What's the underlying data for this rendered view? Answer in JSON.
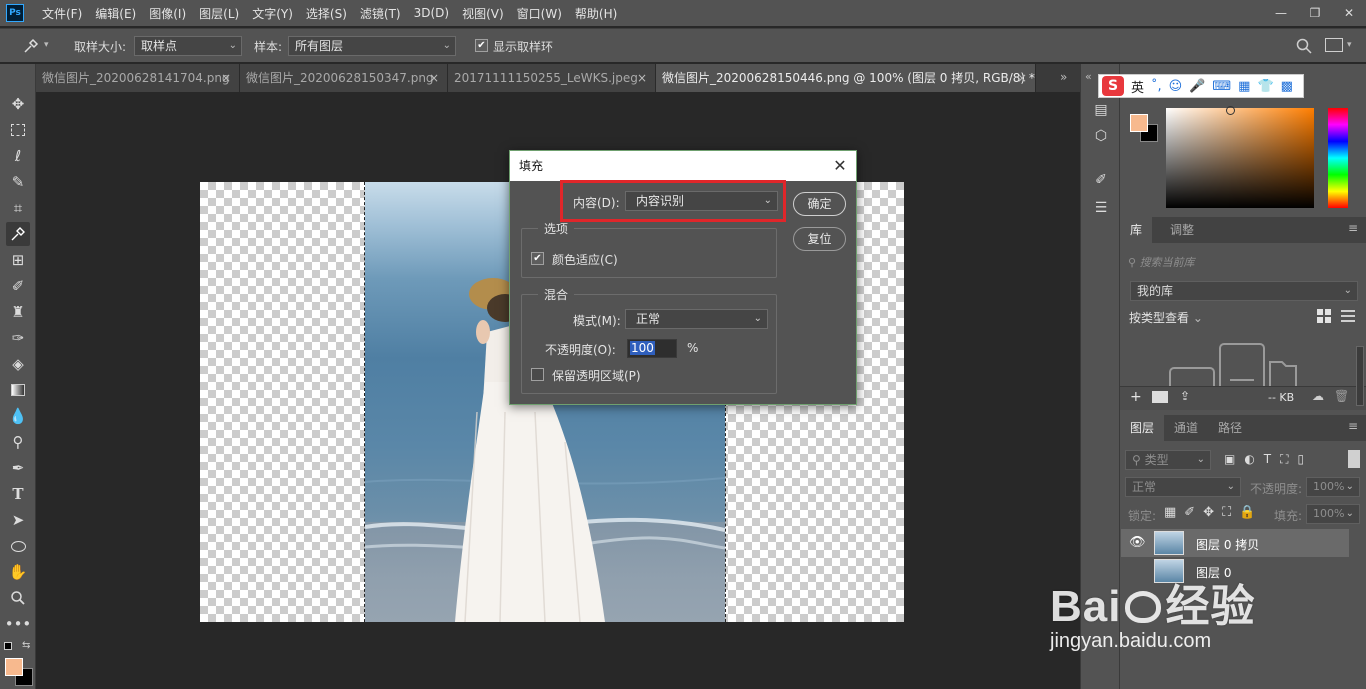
{
  "app": {
    "logo": "Ps"
  },
  "menu": [
    "文件(F)",
    "编辑(E)",
    "图像(I)",
    "图层(L)",
    "文字(Y)",
    "选择(S)",
    "滤镜(T)",
    "3D(D)",
    "视图(V)",
    "窗口(W)",
    "帮助(H)"
  ],
  "window_controls": [
    "—",
    "❐",
    "✕"
  ],
  "options": {
    "sample_size_label": "取样大小:",
    "sample_size_value": "取样点",
    "sample_label": "样本:",
    "sample_value": "所有图层",
    "show_ring_label": "显示取样环",
    "show_ring_checked": true
  },
  "tabs": [
    {
      "label": "微信图片_20200628141704.png",
      "close": "×"
    },
    {
      "label": "微信图片_20200628150347.png",
      "close": "×"
    },
    {
      "label": "20171111150255_LeWKS.jpeg",
      "close": "×"
    },
    {
      "label": "微信图片_20200628150446.png @ 100% (图层 0 拷贝, RGB/8) *",
      "close": "×"
    }
  ],
  "dialog": {
    "title": "填充",
    "close": "✕",
    "content_label": "内容(D):",
    "content_value": "内容识别",
    "ok": "确定",
    "reset": "复位",
    "options_legend": "选项",
    "color_adapt_label": "颜色适应(C)",
    "color_adapt_checked": true,
    "blend_legend": "混合",
    "mode_label": "模式(M):",
    "mode_value": "正常",
    "opacity_label": "不透明度(O):",
    "opacity_value": "100",
    "opacity_unit": "%",
    "preserve_label": "保留透明区域(P)",
    "preserve_checked": false
  },
  "ime": {
    "logo": "S",
    "lang": "英"
  },
  "library": {
    "tabs": [
      "库",
      "调整"
    ],
    "search_placeholder": "搜索当前库",
    "library_name": "我的库",
    "view_by": "按类型查看",
    "size": "-- KB"
  },
  "layers": {
    "tabs": [
      "图层",
      "通道",
      "路径"
    ],
    "filter": "类型",
    "blend_mode": "正常",
    "opacity_label": "不透明度:",
    "opacity_value": "100%",
    "lock_label": "锁定:",
    "fill_label": "填充:",
    "fill_value": "100%",
    "items": [
      {
        "name": "图层 0 拷贝",
        "visible": true,
        "selected": true
      },
      {
        "name": "图层 0",
        "visible": false,
        "selected": false
      }
    ]
  },
  "watermark": {
    "brand": "Bai",
    "brand2": "经验",
    "url": "jingyan.baidu.com"
  },
  "colors": {
    "foreground": "#f7b98e",
    "background": "#000000",
    "highlight": "#e0262a"
  }
}
